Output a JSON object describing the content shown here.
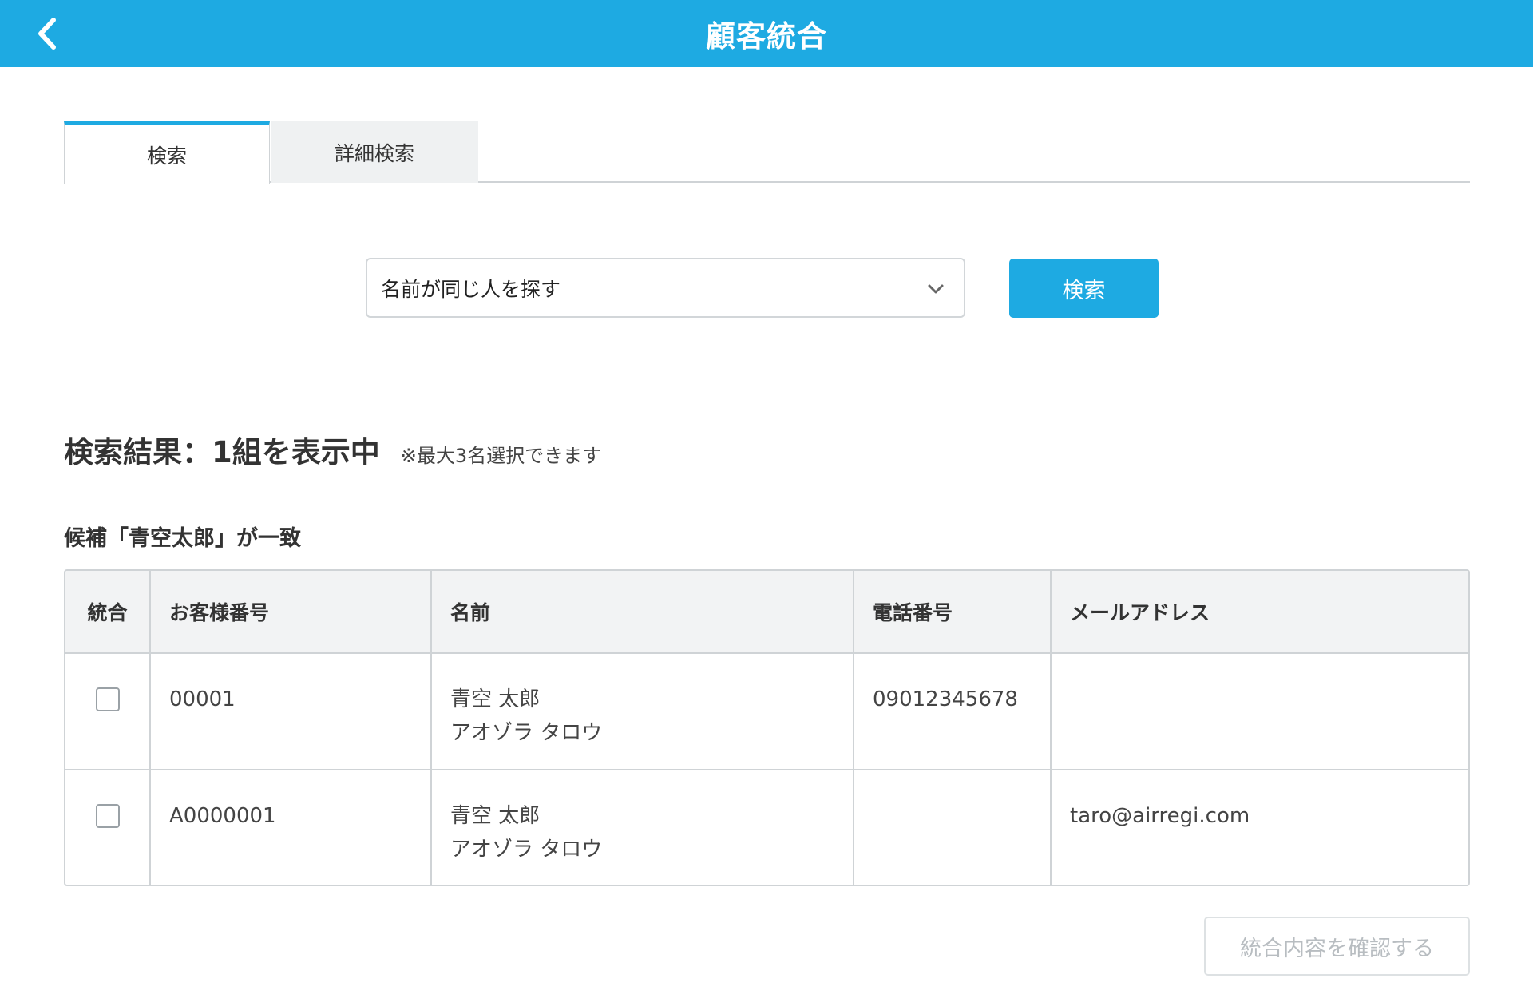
{
  "header": {
    "title": "顧客統合",
    "back_icon": "chevron-left-icon"
  },
  "tabs": [
    {
      "label": "検索",
      "active": true
    },
    {
      "label": "詳細検索",
      "active": false
    }
  ],
  "search": {
    "selected_option": "名前が同じ人を探す",
    "button_label": "検索"
  },
  "results": {
    "title": "検索結果：1組を表示中",
    "note": "※最大3名選択できます",
    "candidate_label": "候補「青空太郎」が一致"
  },
  "table": {
    "headers": [
      "統合",
      "お客様番号",
      "名前",
      "電話番号",
      "メールアドレス"
    ],
    "rows": [
      {
        "checked": false,
        "customer_no": "00001",
        "name": "青空 太郎",
        "kana": "アオゾラ タロウ",
        "phone": "09012345678",
        "email": ""
      },
      {
        "checked": false,
        "customer_no": "A0000001",
        "name": "青空 太郎",
        "kana": "アオゾラ タロウ",
        "phone": "",
        "email": "taro@airregi.com"
      }
    ]
  },
  "footer": {
    "confirm_label": "統合内容を確認する"
  },
  "colors": {
    "accent": "#1eaae2",
    "border": "#cfd3d6",
    "header_bg": "#f2f3f4",
    "disabled_text": "#b8bdc1"
  }
}
